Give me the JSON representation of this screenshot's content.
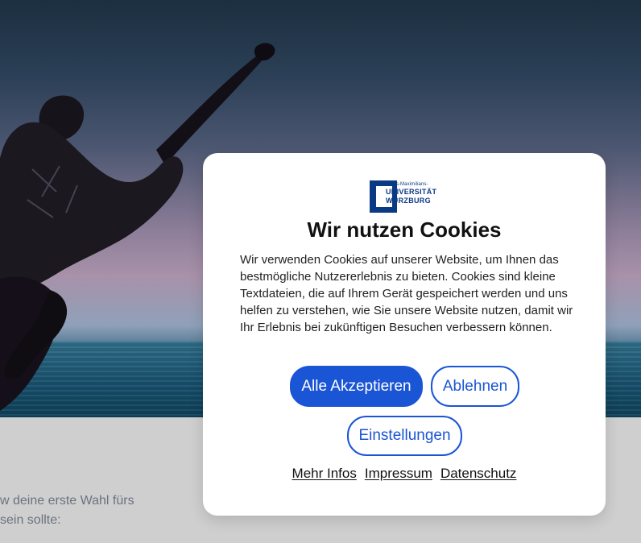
{
  "modal": {
    "logo": {
      "small": "Julius-Maximilians-",
      "line1": "UNIVERSITÄT",
      "line2": "WÜRZBURG"
    },
    "title": "Wir nutzen Cookies",
    "text": "Wir verwenden Cookies auf unserer Website, um Ihnen das bestmögliche Nutzererlebnis zu bieten. Cookies sind kleine Textdateien, die auf Ihrem Gerät gespeichert werden und uns helfen zu verstehen, wie Sie unsere Website nutzen, damit wir Ihr Erlebnis bei zukünftigen Besuchen verbessern können.",
    "buttons": {
      "accept": "Alle Akzeptieren",
      "decline": "Ablehnen",
      "settings": "Einstellungen"
    },
    "links": {
      "more": "Mehr Infos",
      "imprint": "Impressum",
      "privacy": "Datenschutz"
    }
  },
  "background": {
    "line1": "w deine erste Wahl fürs",
    "line2": "sein sollte:"
  },
  "colors": {
    "primary": "#1a55d6",
    "brand_navy": "#0a3a83",
    "modal_bg": "#ffffff",
    "page_bg": "#cfcfcf"
  }
}
